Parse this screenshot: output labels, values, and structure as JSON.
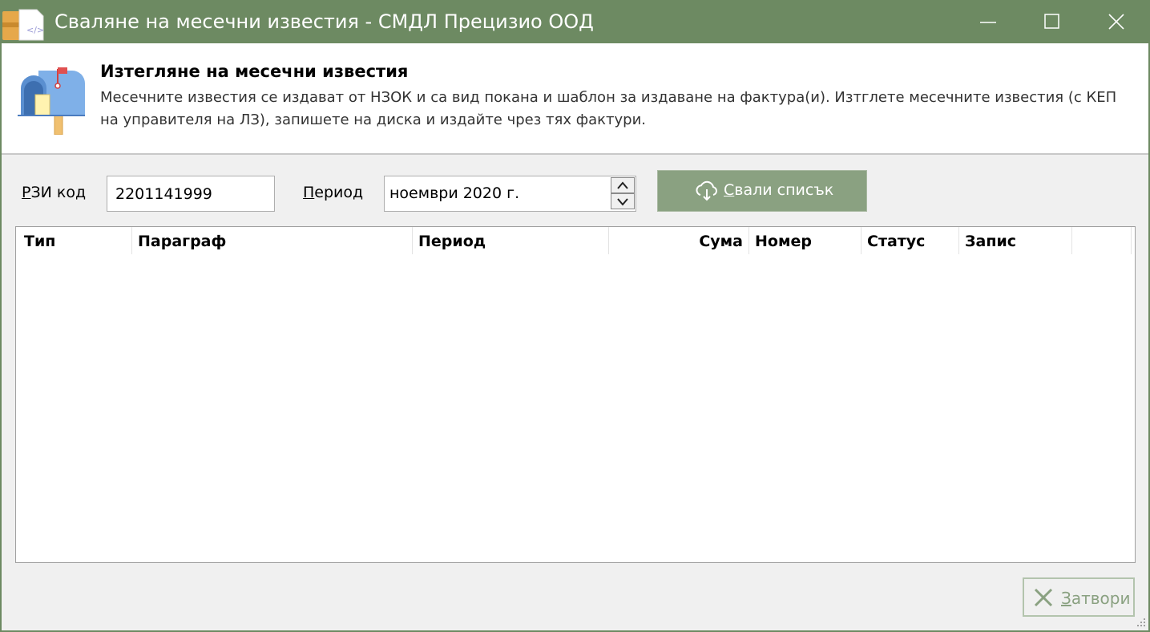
{
  "window": {
    "title": "Сваляне на месечни известия - СМДЛ Прецизио ООД",
    "controls": {
      "minimize": "minimize-icon",
      "maximize": "maximize-icon",
      "close": "close-icon"
    }
  },
  "header": {
    "title": "Изтегляне на месечни известия",
    "description": "Месечните известия се издават от НЗОК и са вид покана и шаблон за издаване на фактура(и). Изтглете месечните известия (с КЕП на управителя на ЛЗ), запишете на диска и издайте чрез тях фактури.",
    "icon": "mailbox-icon"
  },
  "form": {
    "rzi_label_accel": "Р",
    "rzi_label_rest": "ЗИ код",
    "rzi_value": "2201141999",
    "period_label_accel": "П",
    "period_label_rest": "ериод",
    "period_value": "ноември 2020 г.",
    "download_accel": "С",
    "download_rest": "вали списък"
  },
  "grid": {
    "columns": [
      "Тип",
      "Параграф",
      "Период",
      "Сума",
      "Номер",
      "Статус",
      "Запис"
    ],
    "rows": []
  },
  "footer": {
    "close_accel": "З",
    "close_rest": "атвори"
  },
  "colors": {
    "titlebar": "#6d8a62",
    "accent_button": "#8aa181",
    "client_bg": "#f0f0f0"
  }
}
